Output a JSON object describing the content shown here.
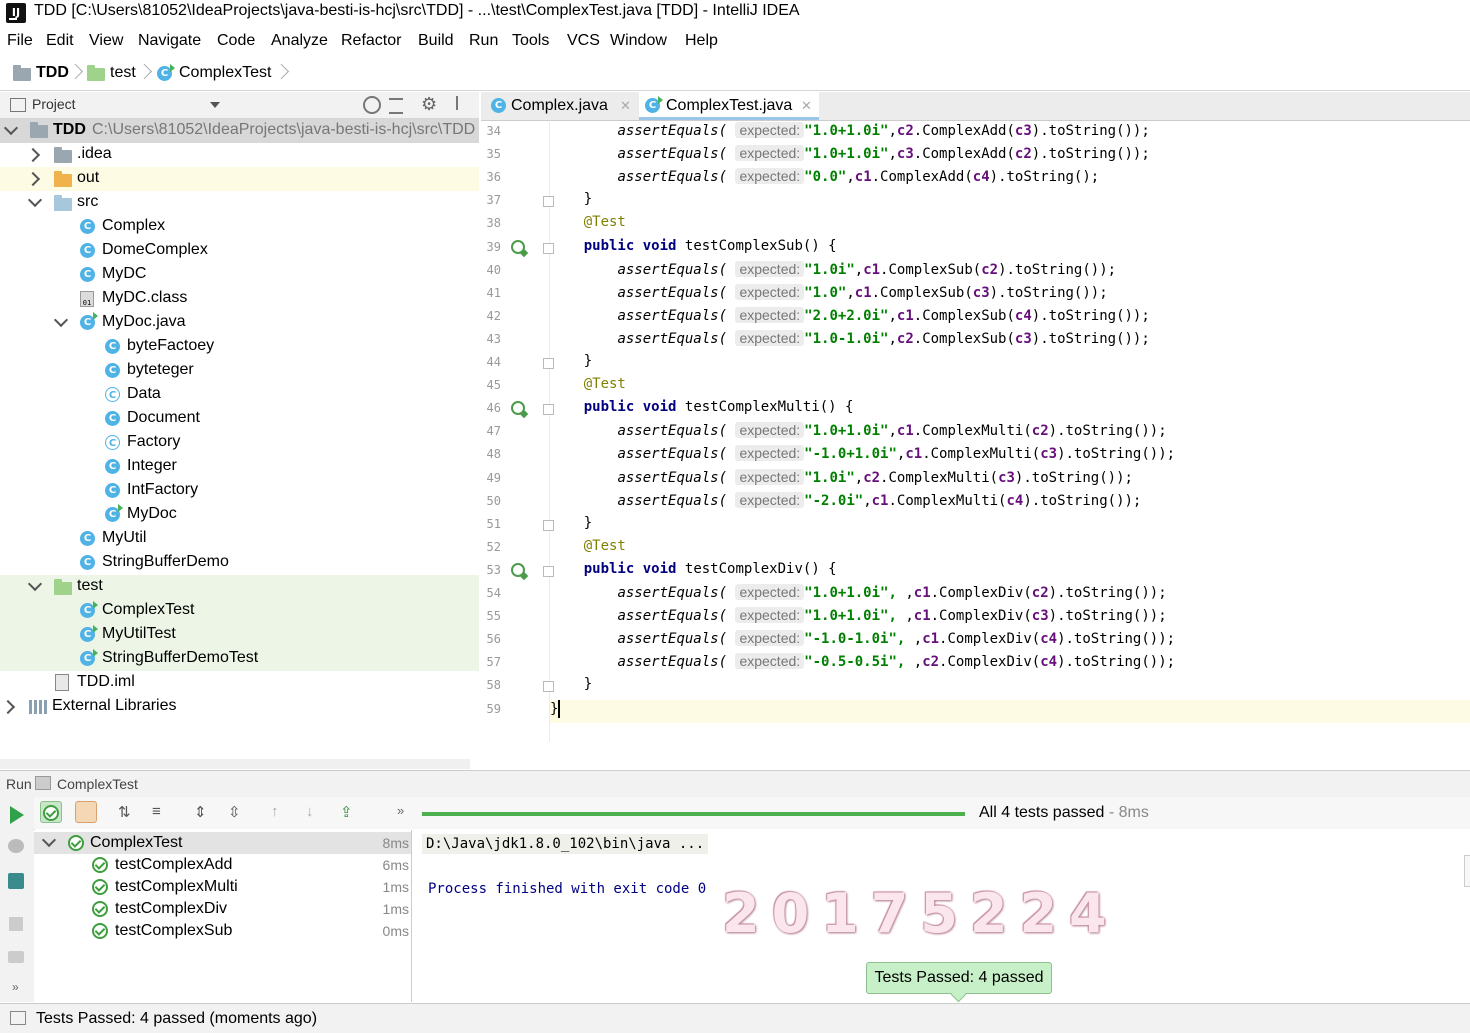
{
  "window": {
    "title": "TDD [C:\\Users\\81052\\IdeaProjects\\java-besti-is-hcj\\src\\TDD] - ...\\test\\ComplexTest.java [TDD] - IntelliJ IDEA"
  },
  "menu": [
    "File",
    "Edit",
    "View",
    "Navigate",
    "Code",
    "Analyze",
    "Refactor",
    "Build",
    "Run",
    "Tools",
    "VCS",
    "Window",
    "Help"
  ],
  "breadcrumb": [
    "TDD",
    "test",
    "ComplexTest"
  ],
  "project": {
    "header": "Project",
    "tree": [
      {
        "label": "TDD",
        "path": "C:\\Users\\81052\\IdeaProjects\\java-besti-is-hcj\\src\\TDD"
      },
      {
        "label": ".idea"
      },
      {
        "label": "out"
      },
      {
        "label": "src"
      },
      {
        "label": "Complex"
      },
      {
        "label": "DomeComplex"
      },
      {
        "label": "MyDC"
      },
      {
        "label": "MyDC.class"
      },
      {
        "label": "MyDoc.java"
      },
      {
        "label": "byteFactoey"
      },
      {
        "label": "byteteger"
      },
      {
        "label": "Data"
      },
      {
        "label": "Document"
      },
      {
        "label": "Factory"
      },
      {
        "label": "Integer"
      },
      {
        "label": "IntFactory"
      },
      {
        "label": "MyDoc"
      },
      {
        "label": "MyUtil"
      },
      {
        "label": "StringBufferDemo"
      },
      {
        "label": "test"
      },
      {
        "label": "ComplexTest"
      },
      {
        "label": "MyUtilTest"
      },
      {
        "label": "StringBufferDemoTest"
      },
      {
        "label": "TDD.iml"
      },
      {
        "label": "External Libraries"
      }
    ]
  },
  "editor": {
    "tabs": [
      {
        "label": "Complex.java",
        "active": false
      },
      {
        "label": "ComplexTest.java",
        "active": true
      }
    ],
    "line_numbers": [
      "34",
      "35",
      "36",
      "37",
      "38",
      "39",
      "40",
      "41",
      "42",
      "43",
      "44",
      "45",
      "46",
      "47",
      "48",
      "49",
      "50",
      "51",
      "52",
      "53",
      "54",
      "55",
      "56",
      "57",
      "58",
      "59"
    ],
    "hint": "expected:",
    "assert": "assertEquals(",
    "test_annotation": "@Test",
    "kw_public": "public",
    "kw_void": "void",
    "brace_close": "}",
    "methods": {
      "sub": "testComplexSub() {",
      "multi": "testComplexMulti() {",
      "div": "testComplexDiv() {"
    },
    "asserts": [
      {
        "str": "\"1.0+1.0i\"",
        "var": "c2",
        "call": ".ComplexAdd(",
        "arg": "c3",
        "end": ").toString());"
      },
      {
        "str": "\"1.0+1.0i\"",
        "var": "c3",
        "call": ".ComplexAdd(",
        "arg": "c2",
        "end": ").toString());"
      },
      {
        "str": "\"0.0\"",
        "var": "c1",
        "call": ".ComplexAdd(",
        "arg": "c4",
        "end": ").toString();"
      },
      {
        "str": "\"1.0i\"",
        "var": "c1",
        "call": ".ComplexSub(",
        "arg": "c2",
        "end": ").toString());"
      },
      {
        "str": "\"1.0\"",
        "var": "c1",
        "call": ".ComplexSub(",
        "arg": "c3",
        "end": ").toString());"
      },
      {
        "str": "\"2.0+2.0i\"",
        "var": "c1",
        "call": ".ComplexSub(",
        "arg": "c4",
        "end": ").toString());"
      },
      {
        "str": "\"1.0-1.0i\"",
        "var": "c2",
        "call": ".ComplexSub(",
        "arg": "c3",
        "end": ").toString());"
      },
      {
        "str": "\"1.0+1.0i\"",
        "var": "c1",
        "call": ".ComplexMulti(",
        "arg": "c2",
        "end": ").toString());"
      },
      {
        "str": "\"-1.0+1.0i\"",
        "var": "c1",
        "call": ".ComplexMulti(",
        "arg": "c3",
        "end": ").toString());"
      },
      {
        "str": "\"1.0i\"",
        "var": "c2",
        "call": ".ComplexMulti(",
        "arg": "c3",
        "end": ").toString());"
      },
      {
        "str": "\"-2.0i\"",
        "var": "c1",
        "call": ".ComplexMulti(",
        "arg": "c4",
        "end": ").toString());"
      },
      {
        "str": "\"1.0+1.0i\", ",
        "var": "c1",
        "call": ".ComplexDiv(",
        "arg": "c2",
        "end": ").toString());"
      },
      {
        "str": "\"1.0+1.0i\", ",
        "var": "c1",
        "call": ".ComplexDiv(",
        "arg": "c3",
        "end": ").toString());"
      },
      {
        "str": "\"-1.0-1.0i\", ",
        "var": "c1",
        "call": ".ComplexDiv(",
        "arg": "c4",
        "end": ").toString());"
      },
      {
        "str": "\"-0.5-0.5i\", ",
        "var": "c2",
        "call": ".ComplexDiv(",
        "arg": "c4",
        "end": ").toString());"
      }
    ]
  },
  "run": {
    "label": "Run",
    "config": "ComplexTest",
    "progress": {
      "fraction": 1.0,
      "text": "All 4 tests passed",
      "time": " - 8ms"
    },
    "tests": [
      {
        "name": "ComplexTest",
        "time": "8ms"
      },
      {
        "name": "testComplexAdd",
        "time": "6ms"
      },
      {
        "name": "testComplexMulti",
        "time": "1ms"
      },
      {
        "name": "testComplexDiv",
        "time": "1ms"
      },
      {
        "name": "testComplexSub",
        "time": "0ms"
      }
    ],
    "console": [
      "D:\\Java\\jdk1.8.0_102\\bin\\java ...",
      "Process finished with exit code 0"
    ],
    "watermark": "20175224",
    "balloon": "Tests Passed: 4 passed"
  },
  "status": {
    "text": "Tests Passed: 4 passed (moments ago)"
  },
  "colors": {
    "accent": "#4fb3e6",
    "pass_green": "#4cb04f",
    "string_green": "#008000",
    "keyword_navy": "#000080",
    "field_purple": "#660e7a"
  }
}
